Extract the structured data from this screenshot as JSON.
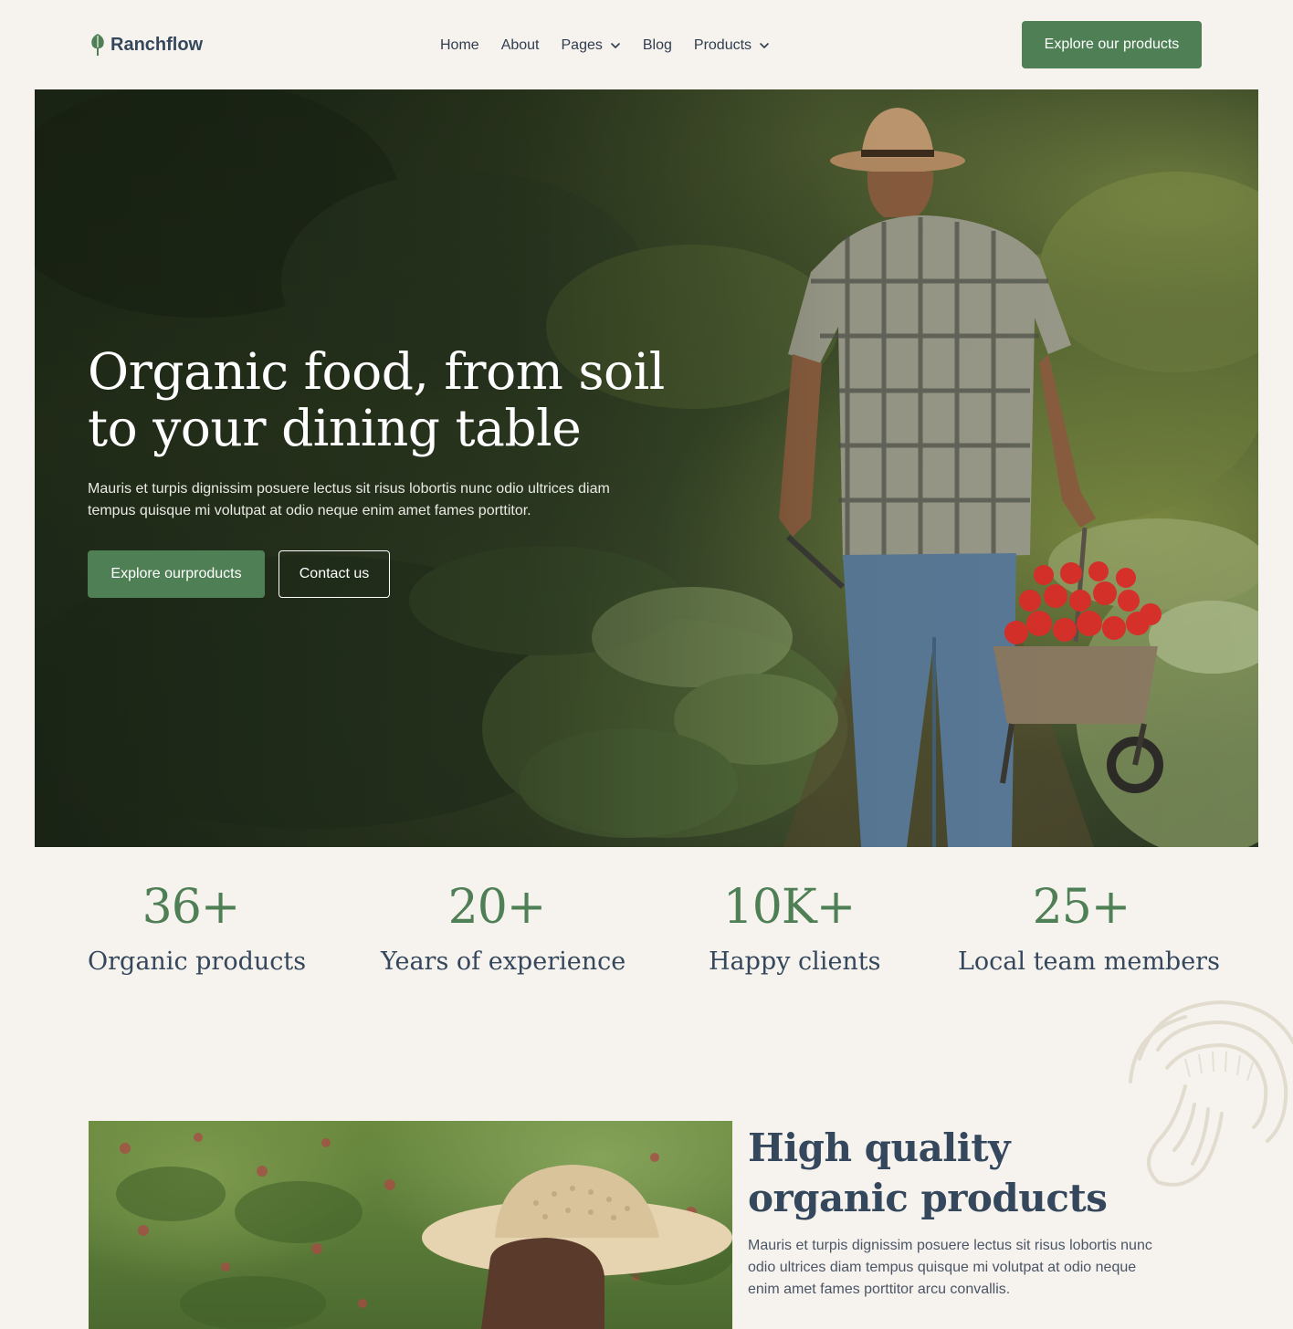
{
  "brand": {
    "name": "Ranchflow",
    "icon": "leaf-icon",
    "accent_color": "#4f7f55",
    "text_color": "#34475c",
    "background_color": "#f6f3ee"
  },
  "nav": {
    "items": [
      {
        "label": "Home",
        "has_dropdown": false
      },
      {
        "label": "About",
        "has_dropdown": false
      },
      {
        "label": "Pages",
        "has_dropdown": true
      },
      {
        "label": "Blog",
        "has_dropdown": false
      },
      {
        "label": "Products",
        "has_dropdown": true
      }
    ],
    "dropdown_icon": "chevron-down-icon",
    "cta_label": "Explore our products"
  },
  "hero": {
    "title": "Organic food, from soil to your dining table",
    "subtitle": "Mauris et turpis dignissim posuere lectus sit risus lobortis nunc odio ultrices diam tempus quisque mi volutpat at odio neque enim amet fames porttitor.",
    "primary_button": "Explore ourproducts",
    "secondary_button": "Contact us"
  },
  "stats": [
    {
      "value": "36+",
      "label": "Organic products"
    },
    {
      "value": "20+",
      "label": "Years of experience"
    },
    {
      "value": "10K+",
      "label": "Happy clients"
    },
    {
      "value": "25+",
      "label": "Local team members"
    }
  ],
  "feature": {
    "title": "High quality organic products",
    "text": "Mauris et turpis dignissim posuere lectus sit risus lobortis nunc odio ultrices diam tempus quisque mi volutpat at odio neque enim amet fames porttitor arcu convallis."
  }
}
